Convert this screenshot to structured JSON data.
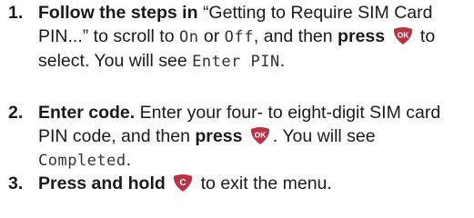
{
  "steps": [
    {
      "number": "1.",
      "action": "Follow the steps in",
      "quote": "“Getting to Require SIM Card PIN...”",
      "t1": " to scroll to ",
      "lcd_on": "On",
      "t2": " or ",
      "lcd_off": "Off",
      "t3": ", and then ",
      "press": "press",
      "key_label": "OK",
      "t4": " to select. You will see ",
      "lcd_result": "Enter PIN",
      "t5": "."
    },
    {
      "number": "2.",
      "action": "Enter code.",
      "t1": " Enter your four- to eight-digit SIM card PIN code, and then ",
      "press": "press",
      "key_label": "OK",
      "t2": ". You will see ",
      "lcd_result": "Completed",
      "t3": "."
    },
    {
      "number": "3.",
      "action": "Press and hold",
      "key_label": "C",
      "t1": " to exit the menu."
    }
  ],
  "colors": {
    "key_fill": "#b73445",
    "key_text": "#ffffff",
    "text": "#1a1a1a"
  },
  "icons": {
    "ok_key": "ok-key-icon",
    "clear_key": "c-key-icon"
  }
}
